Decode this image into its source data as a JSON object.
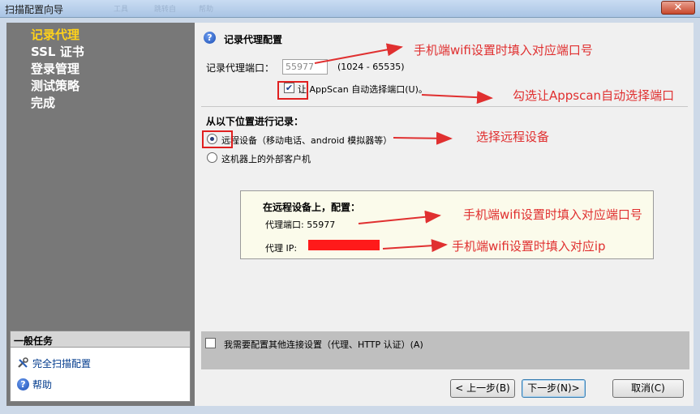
{
  "window": {
    "title": "扫描配置向导",
    "ghost_menu": [
      "工具",
      "跳转自",
      "帮助"
    ],
    "close_label": "✕"
  },
  "nav": {
    "items": [
      {
        "label": "记录代理",
        "active": true
      },
      {
        "label": "SSL 证书",
        "active": false
      },
      {
        "label": "登录管理",
        "active": false
      },
      {
        "label": "测试策略",
        "active": false
      },
      {
        "label": "完成",
        "active": false
      }
    ]
  },
  "tasks": {
    "header": "一般任务",
    "items": [
      {
        "label": "完全扫描配置",
        "icon": "tools-icon"
      },
      {
        "label": "帮助",
        "icon": "help-icon"
      }
    ]
  },
  "main": {
    "section_title": "记录代理配置",
    "port_label": "记录代理端口：",
    "port_value": "55977",
    "port_range": "(1024 - 65535)",
    "auto_select_label": "让 AppScan 自动选择端口(U)。",
    "auto_select_checked": true,
    "location_heading": "从以下位置进行记录：",
    "radio_remote": "远程设备（移动电话、android 模拟器等）",
    "radio_local": "这机器上的外部客户机",
    "remote_box": {
      "title": "在远程设备上，配置：",
      "proxy_port": "代理端口: 55977",
      "proxy_ip_label": "代理 IP:"
    },
    "extra_settings_label": "我需要配置其他连接设置（代理、HTTP 认证）(A)"
  },
  "buttons": {
    "back": "< 上一步(B)",
    "next": "下一步(N)>",
    "cancel": "取消(C)"
  },
  "annotations": {
    "port_note": "手机端wifi设置时填入对应端口号",
    "auto_note": "勾选让Appscan自动选择端口",
    "remote_note": "选择远程设备",
    "proxy_port_note": "手机端wifi设置时填入对应端口号",
    "proxy_ip_note": "手机端wifi设置时填入对应ip"
  },
  "colors": {
    "annotation": "#e03030",
    "nav_active": "#ffd21a",
    "left_panel": "#787878"
  }
}
